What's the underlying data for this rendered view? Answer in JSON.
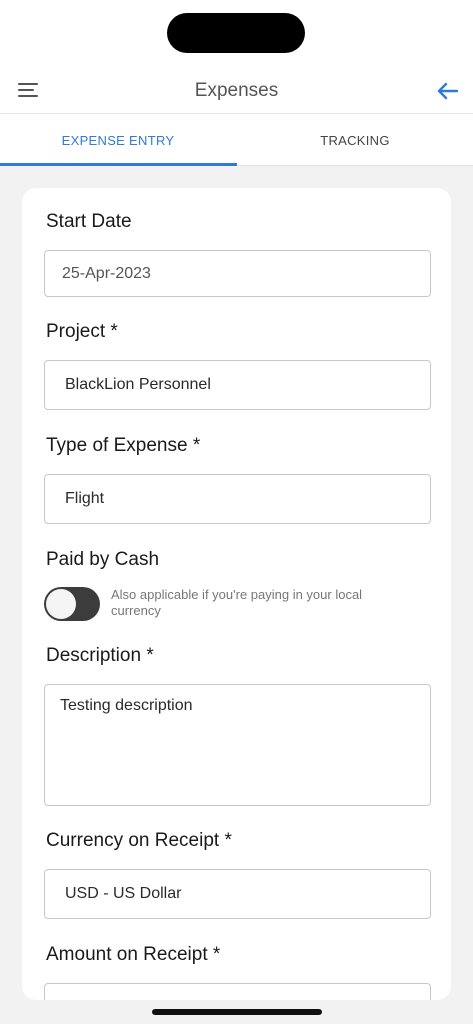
{
  "header": {
    "title": "Expenses",
    "menu_icon": "hamburger-menu-icon",
    "back_icon": "arrow-left-icon",
    "accent_color": "#2f7ad9"
  },
  "tabs": [
    {
      "label": "EXPENSE ENTRY",
      "active": true
    },
    {
      "label": "TRACKING",
      "active": false
    }
  ],
  "form": {
    "start_date": {
      "label": "Start Date",
      "value": "25-Apr-2023"
    },
    "project": {
      "label": "Project *",
      "value": "BlackLion Personnel"
    },
    "expense_type": {
      "label": "Type of Expense *",
      "value": "Flight"
    },
    "paid_by_cash": {
      "label": "Paid by Cash",
      "on": false,
      "hint": "Also applicable if you're paying in your local currency"
    },
    "description": {
      "label": "Description *",
      "value": "Testing description"
    },
    "currency": {
      "label": "Currency on Receipt *",
      "value": "USD - US Dollar"
    },
    "amount": {
      "label": "Amount on Receipt *",
      "value": ""
    }
  }
}
